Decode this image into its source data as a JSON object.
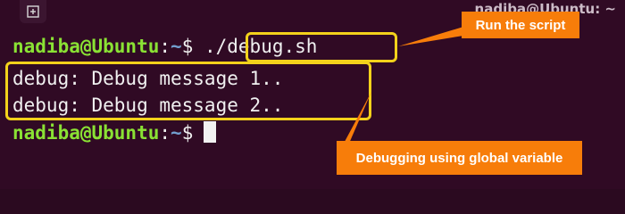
{
  "window": {
    "title": "nadiba@Ubuntu: ~",
    "new_tab_icon": "new-tab-icon"
  },
  "terminal": {
    "lines": [
      {
        "user": "nadiba@Ubuntu",
        "colon": ":",
        "path": "~",
        "dollar": "$ ",
        "command": "./debug.sh"
      },
      {
        "text": "debug: Debug message 1.."
      },
      {
        "text": "debug: Debug message 2.."
      },
      {
        "user": "nadiba@Ubuntu",
        "colon": ":",
        "path": "~",
        "dollar": "$"
      }
    ]
  },
  "annotations": {
    "run_script": "Run the script",
    "debugging_global": "Debugging using global variable"
  },
  "colors": {
    "background": "#300a24",
    "prompt_user": "#8ae234",
    "prompt_path": "#729fcf",
    "highlight_border": "#f3d21b",
    "callout_fill": "#f77d0a"
  }
}
